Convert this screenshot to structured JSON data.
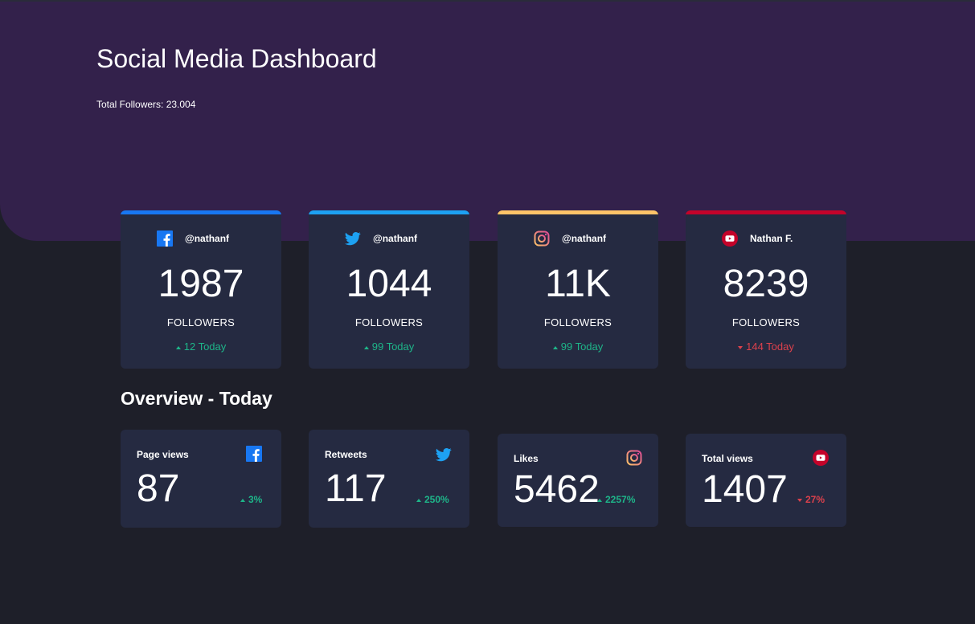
{
  "header": {
    "title": "Social Media Dashboard",
    "total_followers": "Total Followers: 23.004",
    "background_color": "#33214b"
  },
  "followers": [
    {
      "platform": "facebook",
      "icon": "facebook-icon",
      "accent": "#1877f2",
      "handle": "@nathanf",
      "count": "1987",
      "label": "FOLLOWERS",
      "change": "12 Today",
      "trend": "up"
    },
    {
      "platform": "twitter",
      "icon": "twitter-icon",
      "accent": "#1da1f2",
      "handle": "@nathanf",
      "count": "1044",
      "label": "FOLLOWERS",
      "change": "99 Today",
      "trend": "up"
    },
    {
      "platform": "instagram",
      "icon": "instagram-icon",
      "accent": "#fdc468",
      "handle": "@nathanf",
      "count": "11K",
      "label": "FOLLOWERS",
      "change": "99 Today",
      "trend": "up"
    },
    {
      "platform": "youtube",
      "icon": "youtube-icon",
      "accent": "#c4032a",
      "handle": "Nathan F.",
      "count": "8239",
      "label": "FOLLOWERS",
      "change": "144 Today",
      "trend": "down"
    }
  ],
  "overview": {
    "title": "Overview - Today",
    "cards": [
      {
        "metric": "Page views",
        "icon": "facebook-icon",
        "value": "87",
        "percent": "3%",
        "trend": "up"
      },
      {
        "metric": "Retweets",
        "icon": "twitter-icon",
        "value": "117",
        "percent": "250%",
        "trend": "up"
      },
      {
        "metric": "Likes",
        "icon": "instagram-icon",
        "value": "5462",
        "percent": "2257%",
        "trend": "up"
      },
      {
        "metric": "Total views",
        "icon": "youtube-icon",
        "value": "1407",
        "percent": "27%",
        "trend": "down"
      }
    ]
  },
  "colors": {
    "page_bg": "#1e1f29",
    "card_bg": "#252a41",
    "up": "#1eb589",
    "down": "#dc414c"
  }
}
